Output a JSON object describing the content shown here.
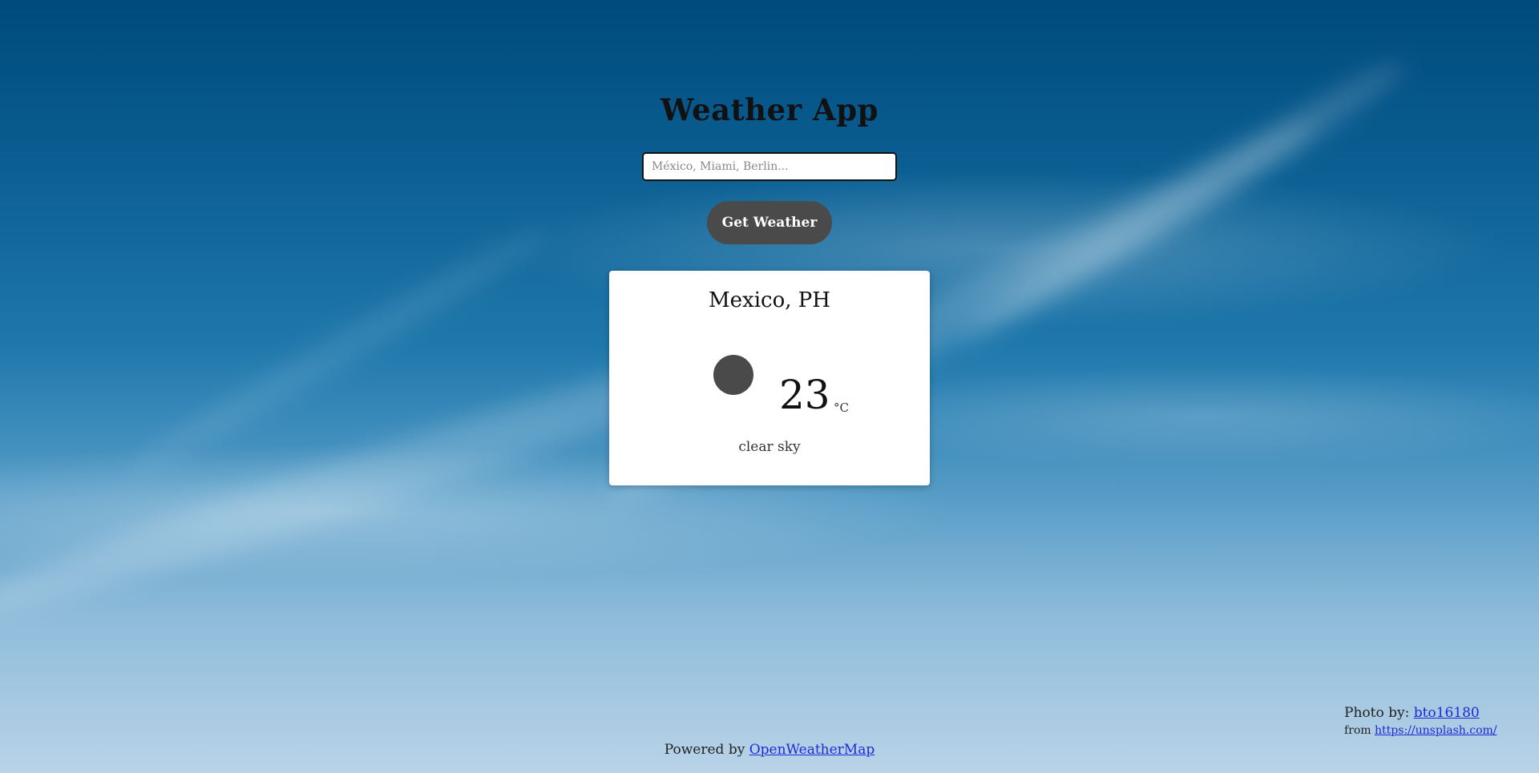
{
  "app": {
    "title": "Weather App"
  },
  "search": {
    "placeholder": "México, Miami, Berlin...",
    "value": ""
  },
  "button": {
    "label": "Get Weather"
  },
  "weather": {
    "location": "Mexico, PH",
    "temperature": "23",
    "unit": "°C",
    "description": "clear sky",
    "icon": "weather-icon-placeholder"
  },
  "footer": {
    "prefix": "Powered by ",
    "link_text": "OpenWeatherMap"
  },
  "credit": {
    "photo_prefix": "Photo by: ",
    "photo_author": "bto16180",
    "from_prefix": "from ",
    "from_link": " https://unsplash.com/"
  },
  "colors": {
    "button_bg": "#4b4a4b",
    "link": "#1a2bd6",
    "card_bg": "#ffffff"
  }
}
